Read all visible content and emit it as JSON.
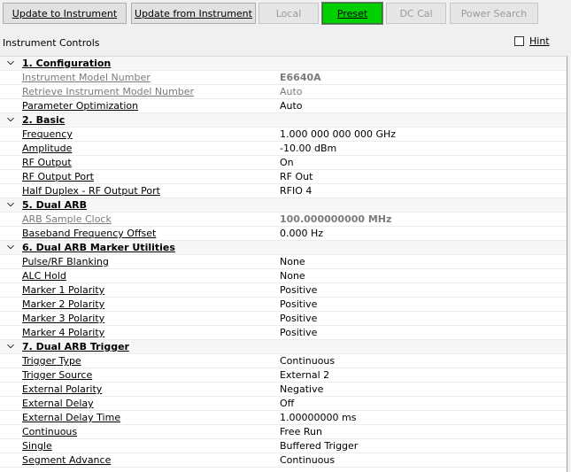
{
  "toolbar": {
    "update_to": "Update to Instrument",
    "update_from": "Update from Instrument",
    "local": "Local",
    "preset": "Preset",
    "dc_cal": "DC Cal",
    "power_search": "Power Search"
  },
  "header": {
    "title": "Instrument Controls",
    "hint": "Hint"
  },
  "colors": {
    "preset": "#00d000",
    "disabled_text": "#9a9a9a"
  },
  "grid": {
    "cat1": {
      "title": "1. Configuration",
      "p": [
        {
          "name": "Instrument Model Number",
          "value": "E6640A"
        },
        {
          "name": "Retrieve Instrument Model Number",
          "value": "Auto"
        },
        {
          "name": "Parameter Optimization",
          "value": "Auto"
        }
      ]
    },
    "cat2": {
      "title": "2. Basic",
      "p": [
        {
          "name": "Frequency",
          "value": "1.000 000 000 000 GHz"
        },
        {
          "name": "Amplitude",
          "value": "-10.00 dBm"
        },
        {
          "name": "RF Output",
          "value": "On"
        },
        {
          "name": "RF Output Port",
          "value": "RF Out"
        },
        {
          "name": "Half Duplex - RF Output Port",
          "value": "RFIO 4"
        }
      ]
    },
    "cat5": {
      "title": "5. Dual ARB",
      "p": [
        {
          "name": "ARB Sample Clock",
          "value": "100.000000000 MHz"
        },
        {
          "name": "Baseband Frequency Offset",
          "value": "0.000 Hz"
        }
      ]
    },
    "cat6": {
      "title": "6. Dual ARB Marker Utilities",
      "p": [
        {
          "name": "Pulse/RF Blanking",
          "value": "None"
        },
        {
          "name": "ALC Hold",
          "value": "None"
        },
        {
          "name": "Marker 1 Polarity",
          "value": "Positive"
        },
        {
          "name": "Marker 2 Polarity",
          "value": "Positive"
        },
        {
          "name": "Marker 3 Polarity",
          "value": "Positive"
        },
        {
          "name": "Marker 4 Polarity",
          "value": "Positive"
        }
      ]
    },
    "cat7": {
      "title": "7. Dual ARB Trigger",
      "p": [
        {
          "name": "Trigger Type",
          "value": "Continuous"
        },
        {
          "name": "Trigger Source",
          "value": "External 2"
        },
        {
          "name": "External Polarity",
          "value": "Negative"
        },
        {
          "name": "External Delay",
          "value": "Off"
        },
        {
          "name": "External Delay Time",
          "value": "1.00000000 ms"
        },
        {
          "name": "Continuous",
          "value": "Free Run"
        },
        {
          "name": "Single",
          "value": "Buffered Trigger"
        },
        {
          "name": "Segment Advance",
          "value": "Continuous"
        }
      ]
    }
  }
}
